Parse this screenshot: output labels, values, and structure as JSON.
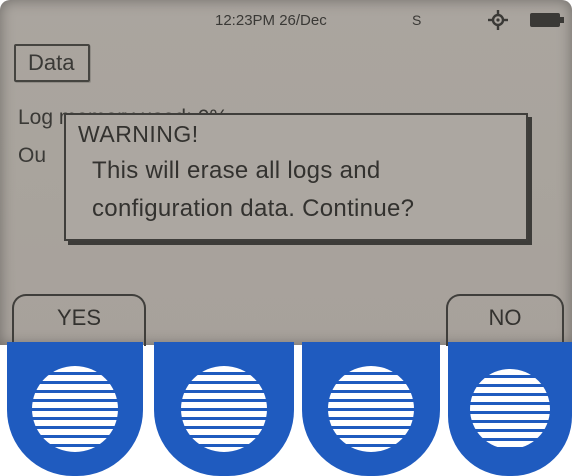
{
  "status_bar": {
    "time_date": "12:23PM 26/Dec",
    "indicator": "S",
    "gps_icon": "gps-crosshair-icon",
    "battery_icon": "battery-icon"
  },
  "tab": {
    "label": "Data"
  },
  "background_lines": {
    "line1": "Log memory used:  0%",
    "line2": "Ou"
  },
  "dialog": {
    "title": "WARNING!",
    "message_line1": "This will erase all logs and",
    "message_line2": "configuration data. Continue?"
  },
  "softkeys": {
    "left_label": "YES",
    "right_label": "NO",
    "key_icon": "speaker-grill-button-icon",
    "key_color": "#1f5bbf"
  },
  "colors": {
    "lcd_background": "#aaa59f",
    "lcd_text": "#3a3936"
  }
}
